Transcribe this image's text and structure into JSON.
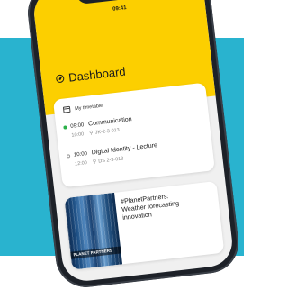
{
  "status_bar": {
    "time": "09:41"
  },
  "header": {
    "title": "Dashboard",
    "icon": "dashboard-icon"
  },
  "timetable": {
    "label": "My timetable",
    "icon": "calendar-icon",
    "entries": [
      {
        "start": "09:00",
        "end": "10:00",
        "title": "Communication",
        "room": "JK-2-3-013",
        "active": true
      },
      {
        "start": "10:00",
        "end": "12:00",
        "title": "Digital Identity - Lecture",
        "room": "DS 2-3-013",
        "active": false
      }
    ]
  },
  "news": {
    "image_caption": "PLANET PARTNERS",
    "title_lines": [
      "#PlanetPartners:",
      "Weather forecasting",
      "innovation"
    ]
  },
  "colors": {
    "brand_yellow": "#fccf00",
    "background_teal": "#29b3cf",
    "active_dot": "#2cb14a"
  }
}
